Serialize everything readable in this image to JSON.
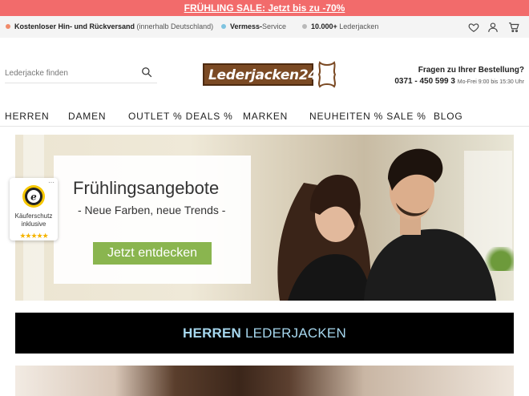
{
  "promo": {
    "text": "FRÜHLING SALE: Jetzt bis zu -70%"
  },
  "usp": [
    {
      "bold": "Kostenloser Hin- und Rückversand",
      "muted": " (innerhalb Deutschland)",
      "color": "#f08a6a"
    },
    {
      "bold": "Vermess-",
      "muted": "Service",
      "color": "#7fc4e0"
    },
    {
      "bold": "10.000+",
      "muted": " Lederjacken",
      "color": "#b9b9b9"
    }
  ],
  "header_icons": [
    "heart-icon",
    "user-icon",
    "cart-icon"
  ],
  "search": {
    "placeholder": "Lederjacke finden"
  },
  "logo": {
    "text": "Lederjacken24"
  },
  "contact": {
    "question": "Fragen zu Ihrer Bestellung?",
    "phone": "0371 - 450 599 3",
    "hours": "Mo-Frei 9:00 bis 15:30 Uhr"
  },
  "nav": [
    "HERREN",
    "DAMEN",
    "OUTLET % DEALS %",
    "MARKEN",
    "NEUHEITEN % SALE %",
    "BLOG"
  ],
  "hero": {
    "title": "Frühlingsangebote",
    "subtitle": "- Neue Farben, neue Trends -",
    "button": "Jetzt entdecken"
  },
  "trust_badge": {
    "line1": "Käuferschutz",
    "line2": "inklusive",
    "stars": "★★★★★",
    "menu": "···"
  },
  "category_banner": {
    "bold": "HERREN",
    "rest": " LEDERJACKEN"
  },
  "colors": {
    "promo_bg": "#f26b6b",
    "cta_green": "#8ab54f",
    "banner_text": "#a6d7ee",
    "logo_brown": "#7b4a24"
  }
}
